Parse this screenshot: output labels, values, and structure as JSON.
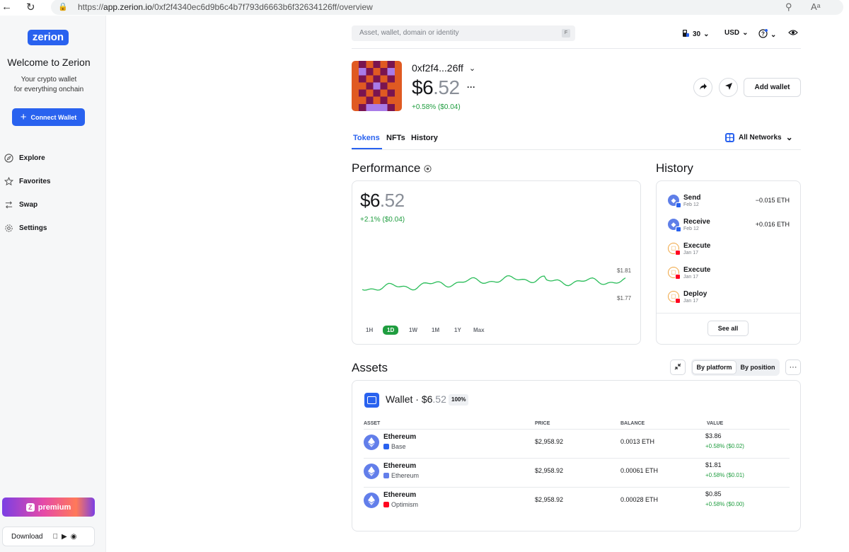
{
  "browser": {
    "url_prefix": "https://",
    "url_host": "app.zerion.io",
    "url_path": "/0xf2f4340ec6d9b6c4b7f793d6663b6f32634126ff/overview",
    "reader_icon": "Aᵃ"
  },
  "sidebar": {
    "logo": "zerion",
    "welcome_title": "Welcome to Zerion",
    "welcome_line1": "Your crypto wallet",
    "welcome_line2": "for everything onchain",
    "connect_label": "Connect Wallet",
    "nav": [
      {
        "label": "Explore",
        "icon": "compass-icon"
      },
      {
        "label": "Favorites",
        "icon": "star-icon"
      },
      {
        "label": "Swap",
        "icon": "swap-icon"
      },
      {
        "label": "Settings",
        "icon": "gear-icon"
      }
    ],
    "premium_label": "premium",
    "premium_badge": "Z",
    "download_label": "Download"
  },
  "header": {
    "search_placeholder": "Asset, wallet, domain or identity",
    "search_shortcut": "F",
    "gas_value": "30",
    "currency": "USD"
  },
  "wallet": {
    "address": "0xf2f4...26ff",
    "balance_whole": "$6",
    "balance_decimal": ".52",
    "more": "···",
    "change": "+0.58% ($0.04)",
    "add_wallet_label": "Add wallet"
  },
  "tabs": [
    {
      "label": "Tokens",
      "active": true
    },
    {
      "label": "NFTs",
      "active": false
    },
    {
      "label": "History",
      "active": false
    }
  ],
  "networks_label": "All Networks",
  "performance": {
    "title": "Performance",
    "balance_whole": "$6",
    "balance_decimal": ".52",
    "change": "+2.1% ($0.04)",
    "y_high": "$1.81",
    "y_low": "$1.77",
    "ranges": [
      "1H",
      "1D",
      "1W",
      "1M",
      "1Y",
      "Max"
    ],
    "active_range": "1D",
    "line_color": "#2bbd5a"
  },
  "history": {
    "title": "History",
    "items": [
      {
        "type": "Send",
        "date": "Feb 12",
        "amount": "−0.015 ETH",
        "icon": "ethereum-icon"
      },
      {
        "type": "Receive",
        "date": "Feb 12",
        "amount": "+0.016 ETH",
        "icon": "ethereum-icon"
      },
      {
        "type": "Execute",
        "date": "Jan 17",
        "amount": "",
        "icon": "contract-icon"
      },
      {
        "type": "Execute",
        "date": "Jan 17",
        "amount": "",
        "icon": "contract-icon"
      },
      {
        "type": "Deploy",
        "date": "Jan 17",
        "amount": "",
        "icon": "contract-icon"
      }
    ],
    "see_all_label": "See all"
  },
  "assets": {
    "title": "Assets",
    "by_platform_label": "By platform",
    "by_position_label": "By position",
    "more": "···",
    "wallet_label": "Wallet · ",
    "wallet_whole": "$6",
    "wallet_decimal": ".52",
    "wallet_pct": "100%",
    "columns": [
      "ASSET",
      "PRICE",
      "BALANCE",
      "VALUE"
    ],
    "rows": [
      {
        "name": "Ethereum",
        "chain": "Base",
        "chain_color": "#2962ef",
        "price": "$2,958.92",
        "balance": "0.0013 ETH",
        "value": "$3.86",
        "change": "+0.58% ($0.02)"
      },
      {
        "name": "Ethereum",
        "chain": "Ethereum",
        "chain_color": "#627eea",
        "price": "$2,958.92",
        "balance": "0.00061 ETH",
        "value": "$1.81",
        "change": "+0.58% ($0.01)"
      },
      {
        "name": "Ethereum",
        "chain": "Optimism",
        "chain_color": "#ff0420",
        "price": "$2,958.92",
        "balance": "0.00028 ETH",
        "value": "$0.85",
        "change": "+0.58% ($0.00)"
      }
    ]
  },
  "colors": {
    "accent": "#2962ef",
    "positive": "#1f9d3f"
  }
}
